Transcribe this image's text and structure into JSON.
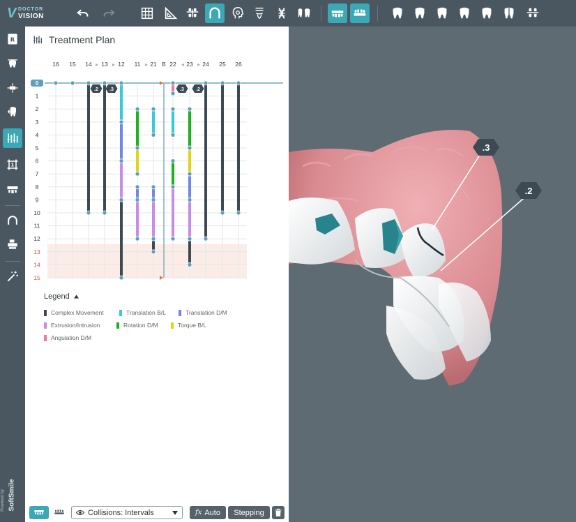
{
  "app": {
    "logo_top": "DOCTOR",
    "logo_bottom": "VISION",
    "powered_label": "Powered by",
    "powered_brand": "SoftSmile"
  },
  "panel": {
    "title": "Treatment Plan",
    "legend_title": "Legend",
    "legend": [
      {
        "label": "Complex Movement",
        "color": "#3d4a53"
      },
      {
        "label": "Translation B/L",
        "color": "#35c9e0"
      },
      {
        "label": "Translation D/M",
        "color": "#6f86ea"
      },
      {
        "label": "Extrusion/Intrusion",
        "color": "#c98be8"
      },
      {
        "label": "Rotation D/M",
        "color": "#1bb31b"
      },
      {
        "label": "Torque B/L",
        "color": "#dfd515"
      },
      {
        "label": "Angulation D/M",
        "color": "#ee7a99"
      }
    ]
  },
  "chart_data": {
    "type": "table",
    "columns": [
      "16",
      "15",
      "14",
      "13",
      "12",
      "11",
      "21",
      "B",
      "22",
      "23",
      "24",
      "25",
      "26"
    ],
    "rows": [
      0,
      1,
      2,
      3,
      4,
      5,
      6,
      7,
      8,
      9,
      10,
      11,
      12,
      13,
      14,
      15
    ],
    "overflow_from": 13,
    "badges": [
      {
        "col": "14",
        "label": ".2"
      },
      {
        "col": "13",
        "label": ".3"
      },
      {
        "col": "22",
        "label": ".3"
      },
      {
        "col": "23",
        "label": ".2"
      }
    ],
    "bars": [
      {
        "col": "14",
        "segments": [
          {
            "from": 0,
            "to": 10,
            "type": "Complex Movement"
          }
        ]
      },
      {
        "col": "13",
        "segments": [
          {
            "from": 0,
            "to": 10,
            "type": "Complex Movement"
          }
        ]
      },
      {
        "col": "12",
        "segments": [
          {
            "from": 0,
            "to": 3,
            "type": "Translation B/L"
          },
          {
            "from": 3,
            "to": 6,
            "type": "Translation D/M"
          },
          {
            "from": 6,
            "to": 9,
            "type": "Extrusion/Intrusion"
          },
          {
            "from": 9,
            "to": 15,
            "type": "Complex Movement"
          }
        ]
      },
      {
        "col": "11",
        "segments": [
          {
            "from": 2,
            "to": 5,
            "type": "Rotation D/M"
          },
          {
            "from": 5,
            "to": 7,
            "type": "Torque B/L"
          },
          {
            "from": 8,
            "to": 9,
            "type": "Translation D/M"
          },
          {
            "from": 9,
            "to": 12,
            "type": "Extrusion/Intrusion"
          }
        ]
      },
      {
        "col": "21",
        "segments": [
          {
            "from": 2,
            "to": 4,
            "type": "Translation B/L"
          },
          {
            "from": 8,
            "to": 9,
            "type": "Translation D/M"
          },
          {
            "from": 9,
            "to": 12,
            "type": "Extrusion/Intrusion"
          },
          {
            "from": 12,
            "to": 13,
            "type": "Complex Movement"
          }
        ]
      },
      {
        "col": "22",
        "segments": [
          {
            "from": 0,
            "to": 0.8,
            "type": "Angulation D/M"
          },
          {
            "from": 2,
            "to": 4,
            "type": "Translation B/L"
          },
          {
            "from": 6,
            "to": 8,
            "type": "Rotation D/M"
          },
          {
            "from": 8,
            "to": 12,
            "type": "Extrusion/Intrusion"
          }
        ]
      },
      {
        "col": "23",
        "segments": [
          {
            "from": 2,
            "to": 5,
            "type": "Rotation D/M"
          },
          {
            "from": 5,
            "to": 7,
            "type": "Torque B/L"
          },
          {
            "from": 7,
            "to": 9,
            "type": "Translation D/M"
          },
          {
            "from": 9,
            "to": 12,
            "type": "Extrusion/Intrusion"
          },
          {
            "from": 12,
            "to": 14,
            "type": "Complex Movement"
          }
        ]
      },
      {
        "col": "24",
        "segments": [
          {
            "from": 0,
            "to": 12,
            "type": "Complex Movement"
          }
        ]
      },
      {
        "col": "25",
        "segments": [
          {
            "from": 0,
            "to": 10,
            "type": "Complex Movement"
          }
        ]
      },
      {
        "col": "26",
        "segments": [
          {
            "from": 0,
            "to": 10,
            "type": "Complex Movement"
          }
        ]
      }
    ]
  },
  "view3d": {
    "annotations": [
      ".3",
      ".2"
    ]
  },
  "bottombar": {
    "collisions_label": "Collisions: Intervals",
    "auto_label": "Auto",
    "fx_label": "fx",
    "stepping_label": "Stepping"
  }
}
